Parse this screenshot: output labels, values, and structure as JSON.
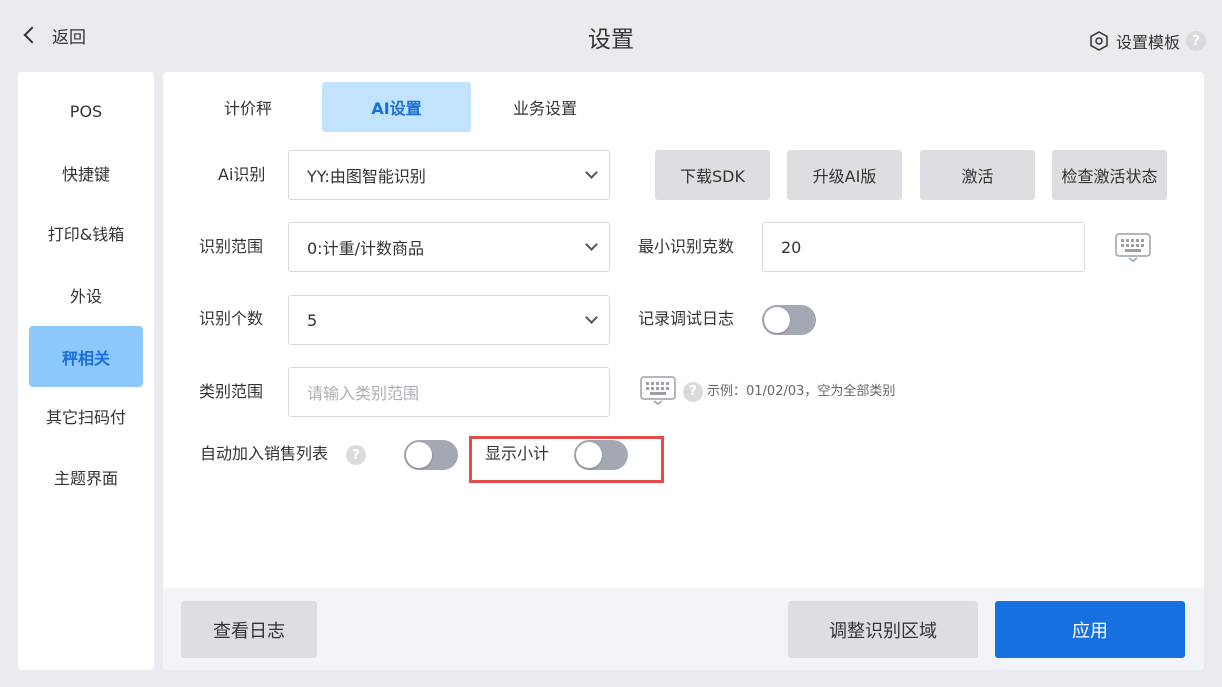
{
  "header": {
    "back_label": "返回",
    "title": "设置",
    "template_label": "设置模板",
    "help_mark": "?"
  },
  "sidebar": {
    "items": [
      {
        "label": "POS",
        "active": false
      },
      {
        "label": "快捷键",
        "active": false
      },
      {
        "label": "打印&钱箱",
        "active": false
      },
      {
        "label": "外设",
        "active": false
      },
      {
        "label": "秤相关",
        "active": true
      },
      {
        "label": "其它扫码付",
        "active": false
      },
      {
        "label": "主题界面",
        "active": false
      }
    ]
  },
  "tabs": [
    {
      "label": "计价秤",
      "active": false
    },
    {
      "label": "AI设置",
      "active": true
    },
    {
      "label": "业务设置",
      "active": false
    }
  ],
  "form": {
    "ai_recognition": {
      "label": "Ai识别",
      "value": "YY:由图智能识别"
    },
    "recognition_range": {
      "label": "识别范围",
      "value": "0:计重/计数商品"
    },
    "recognition_count": {
      "label": "识别个数",
      "value": "5"
    },
    "category_range": {
      "label": "类别范围",
      "placeholder": "请输入类别范围",
      "hint": "示例：01/02/03，空为全部类别"
    },
    "min_grams": {
      "label": "最小识别克数",
      "value": "20"
    },
    "debug_log": {
      "label": "记录调试日志",
      "on": false
    },
    "auto_add_sales": {
      "label": "自动加入销售列表",
      "on": false
    },
    "show_subtotal": {
      "label": "显示小计",
      "on": false
    }
  },
  "action_buttons": {
    "download_sdk": "下载SDK",
    "upgrade_ai": "升级AI版",
    "activate": "激活",
    "check_activation": "检查激活状态"
  },
  "footer": {
    "view_log": "查看日志",
    "adjust_region": "调整识别区域",
    "apply": "应用"
  },
  "colors": {
    "accent": "#1670e0",
    "active_sidebar_bg": "#8cc8fb",
    "active_tab_bg": "#c2e3fd",
    "toggle_off": "#a3a8b3",
    "highlight_border": "#e54b4b"
  }
}
